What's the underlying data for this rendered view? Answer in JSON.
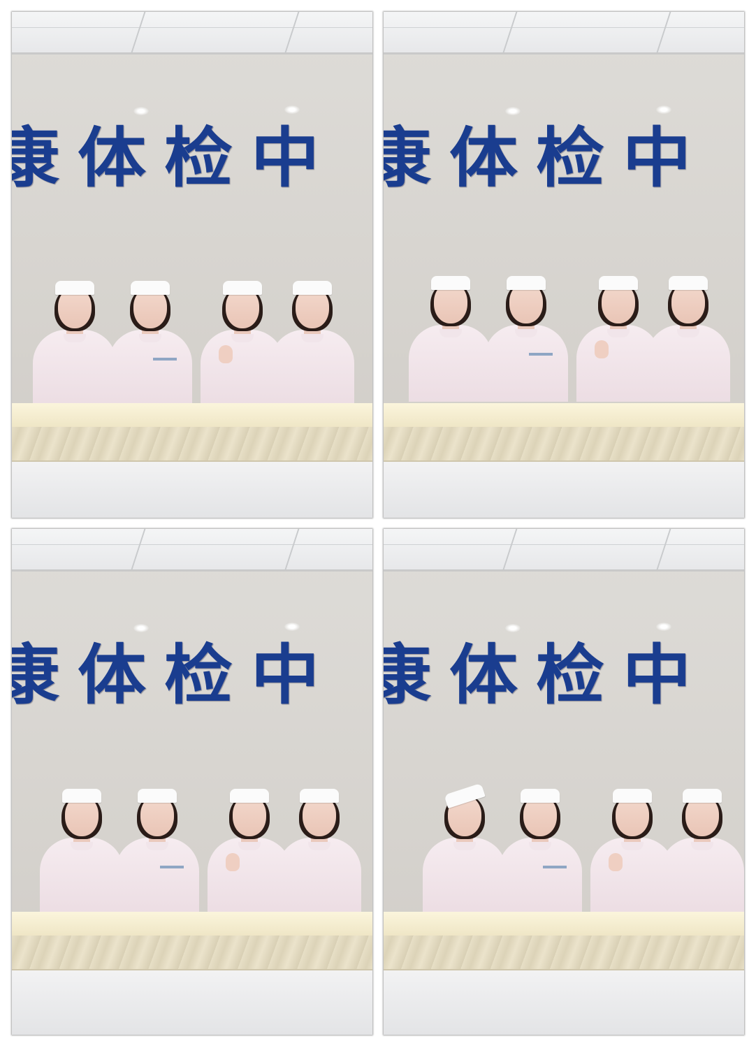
{
  "photo_collage": {
    "layout": "2x2",
    "panels": [
      {
        "sign_text": "康体检中"
      },
      {
        "sign_text": "康体检中"
      },
      {
        "sign_text": "康体检中"
      },
      {
        "sign_text": "康体检中"
      }
    ]
  },
  "colors": {
    "sign_blue": "#1a3d8f",
    "uniform_pink": "#f6ecf0",
    "wall": "#d6d3ce",
    "counter": "#f0e7c8"
  }
}
